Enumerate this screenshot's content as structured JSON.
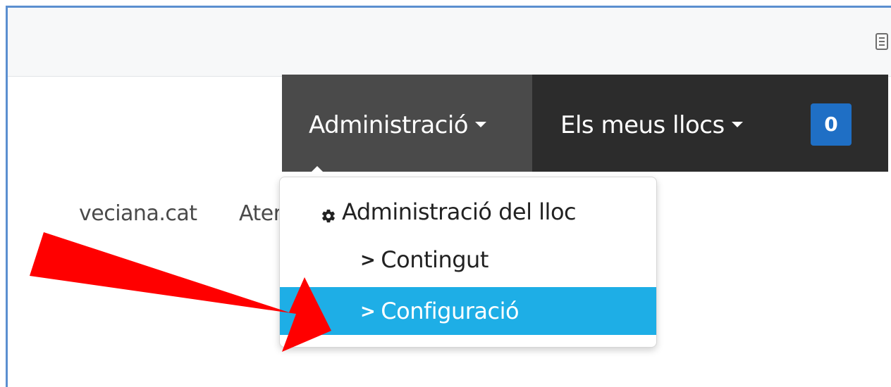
{
  "toolbar": {
    "icon": "reader-view-icon"
  },
  "navbar": {
    "admin_label": "Administració",
    "sites_label": "Els meus llocs",
    "notification_count": "0",
    "colors": {
      "bar": "#2c2c2c",
      "active": "#4a4a4a",
      "badge": "#1f6fc5"
    }
  },
  "background": {
    "site_link": "veciana.cat",
    "partial_link": "Ater"
  },
  "dropdown": {
    "header_label": "Administració del lloc",
    "header_icon": "gear-icon",
    "items": [
      {
        "label": "Contingut",
        "icon": "chevron-right-icon",
        "highlighted": false
      },
      {
        "label": "Configuració",
        "icon": "chevron-right-icon",
        "highlighted": true
      }
    ],
    "highlight_color": "#1eaee6"
  },
  "annotation": {
    "arrow_color": "#ff0000"
  }
}
